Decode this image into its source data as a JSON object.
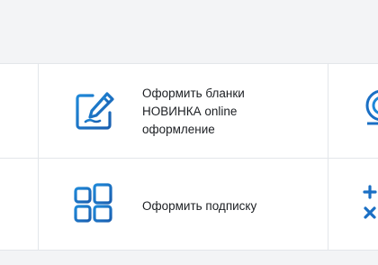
{
  "tiles": [
    {
      "label": "Оформить бланки\nНОВИНКА online\nоформление",
      "icon": "edit-form-icon"
    },
    {
      "label": "Оформить подписку",
      "icon": "grid-blocks-icon"
    }
  ],
  "edge_icons": [
    "concentric-arcs-icon",
    "plus-cross-icon"
  ],
  "colors": {
    "icon_blue": "#1a6fc4",
    "icon_light_blue": "#1e88d8",
    "text": "#1c1f23",
    "divider": "#e3e6ea",
    "background": "#f3f4f6"
  }
}
